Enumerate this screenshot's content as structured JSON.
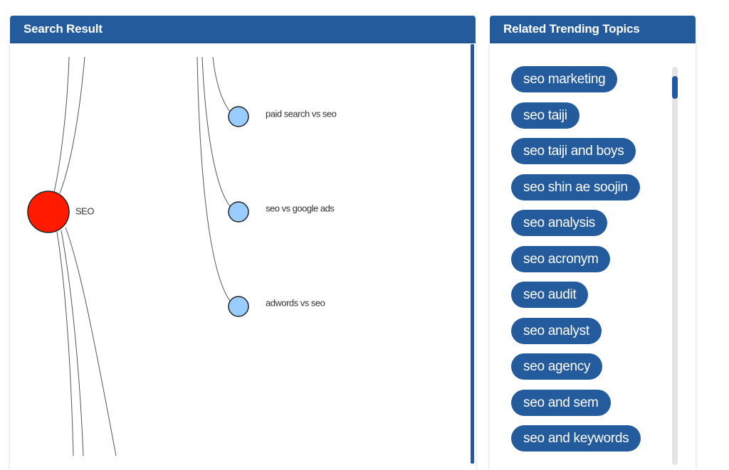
{
  "left_panel": {
    "title": "Search Result"
  },
  "graph": {
    "root": {
      "label": "SEO",
      "color": "#ff1a00"
    },
    "children": [
      {
        "label": "paid search vs seo",
        "color": "#99ccff"
      },
      {
        "label": "seo vs google ads",
        "color": "#99ccff"
      },
      {
        "label": "adwords vs seo",
        "color": "#99ccff"
      }
    ],
    "edge_color": "#555555"
  },
  "right_panel": {
    "title": "Related Trending Topics",
    "topics": [
      "seo marketing",
      "seo taiji",
      "seo taiji and boys",
      "seo shin ae soojin",
      "seo analysis",
      "seo acronym",
      "seo audit",
      "seo analyst",
      "seo agency",
      "seo and sem",
      "seo and keywords"
    ]
  },
  "colors": {
    "header_bg": "#235b9c",
    "accent": "#1e58a6"
  }
}
